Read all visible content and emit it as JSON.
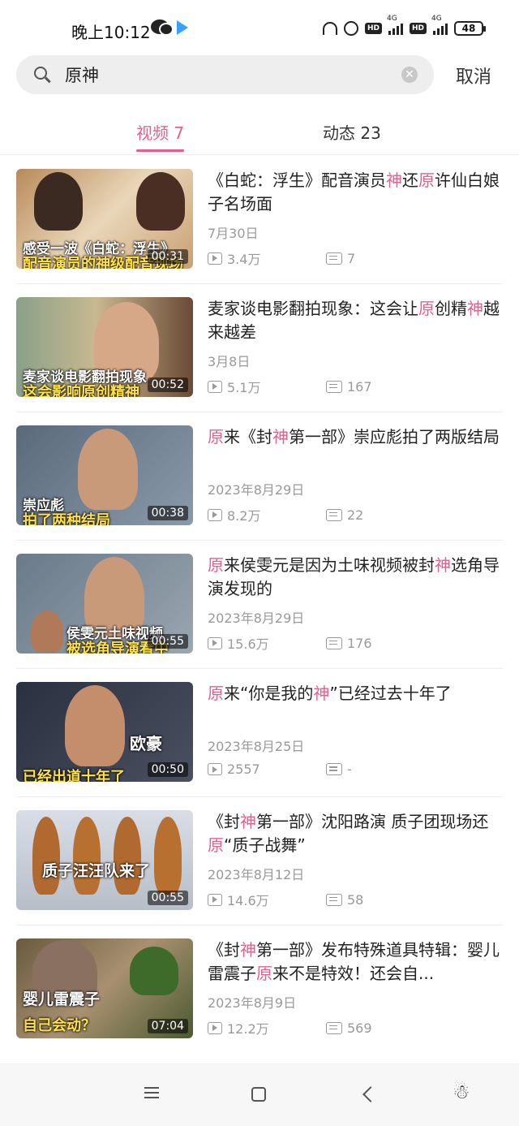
{
  "status_bar": {
    "time": "晚上10:12",
    "hd1": "HD",
    "hd2": "HD",
    "net1": "4G",
    "net2": "4G",
    "battery": "48"
  },
  "search": {
    "query": "原神",
    "cancel_label": "取消"
  },
  "tabs": [
    {
      "label": "视频 7",
      "active": true
    },
    {
      "label": "动态 23",
      "active": false
    }
  ],
  "accent_color": "#e0608f",
  "videos": [
    {
      "title_parts": [
        "《白蛇：浮生》配音演员",
        "神",
        "还",
        "原",
        "许仙白娘子名场面"
      ],
      "date": "7月30日",
      "views": "3.4万",
      "danmaku": "7",
      "duration": "00:31",
      "thumb_caption": "感受一波《白蛇：浮生》",
      "thumb_caption2": "配音演员的神级配音现场"
    },
    {
      "title_parts": [
        "麦家谈电影翻拍现象：这会让",
        "原",
        "创精",
        "神",
        "越来越差"
      ],
      "date": "3月8日",
      "views": "5.1万",
      "danmaku": "167",
      "duration": "00:52",
      "thumb_caption": "麦家谈电影翻拍现象",
      "thumb_caption2": "这会影响原创精神"
    },
    {
      "title_parts": [
        "",
        "原",
        "来《封",
        "神",
        "第一部》崇应彪拍了两版结局"
      ],
      "date": "2023年8月29日",
      "views": "8.2万",
      "danmaku": "22",
      "duration": "00:38",
      "thumb_caption": "崇应彪",
      "thumb_caption2": "拍了两种结局"
    },
    {
      "title_parts": [
        "",
        "原",
        "来侯雯元是因为土味视频被封",
        "神",
        "选角导演发现的"
      ],
      "date": "2023年8月29日",
      "views": "15.6万",
      "danmaku": "176",
      "duration": "00:55",
      "thumb_caption": "侯雯元土味视频",
      "thumb_caption2": "被选角导演看中"
    },
    {
      "title_parts": [
        "",
        "原",
        "来“你是我的",
        "神",
        "”已经过去十年了"
      ],
      "date": "2023年8月25日",
      "views": "2557",
      "danmaku": "-",
      "duration": "00:50",
      "thumb_caption": "欧豪",
      "thumb_caption2": "已经出道十年了"
    },
    {
      "title_parts": [
        "《封",
        "神",
        "第一部》沈阳路演 质子团现场还",
        "原",
        "“质子战舞”"
      ],
      "date": "2023年8月12日",
      "views": "14.6万",
      "danmaku": "58",
      "duration": "00:55",
      "thumb_caption": "质子汪汪队来了",
      "thumb_caption2": ""
    },
    {
      "title_parts": [
        "《封",
        "神",
        "第一部》发布特殊道具特辑：婴儿雷震子",
        "原",
        "来不是特效！还会自..."
      ],
      "date": "2023年8月9日",
      "views": "12.2万",
      "danmaku": "569",
      "duration": "07:04",
      "thumb_caption": "婴儿雷震子",
      "thumb_caption2": "自己会动？"
    }
  ]
}
